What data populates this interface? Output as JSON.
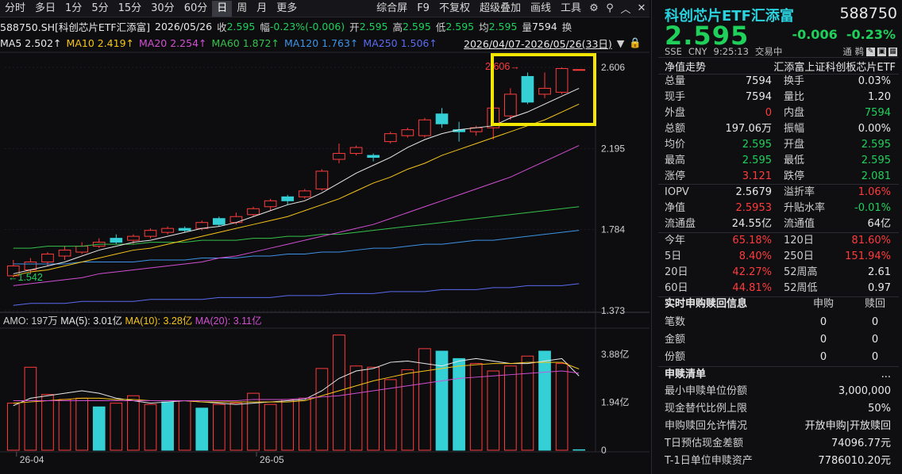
{
  "toolbar": {
    "left": [
      "分时",
      "多日",
      "1分",
      "5分",
      "15分",
      "30分",
      "60分",
      "日",
      "周",
      "月",
      "更多"
    ],
    "active": "日",
    "right": [
      "综合屏",
      "F9",
      "不复权",
      "超级叠加",
      "画线",
      "工具"
    ]
  },
  "info": {
    "code": "588750.SH[科创芯片ETF汇添富]",
    "date": "2026/05/26",
    "close_label": "收",
    "close": "2.595",
    "range_label": "幅",
    "range": "-0.23%(-0.006)",
    "open_label": "开",
    "open": "2.595",
    "high_label": "高",
    "high": "2.595",
    "low_label": "低",
    "low": "2.595",
    "avg_label": "均",
    "avg": "2.595",
    "vol_label": "量",
    "vol": "7594",
    "more": "换"
  },
  "ma_row": {
    "ma5": "MA5 2.502↑",
    "ma10": "MA10 2.419↑",
    "ma20": "MA20 2.254↑",
    "ma60": "MA60 1.872↑",
    "ma120": "MA120 1.763↑",
    "ma250": "MA250 1.506↑",
    "range": "2026/04/07-2026/05/26(33日)"
  },
  "colors": {
    "up": "#ff3b3b",
    "down_fill": "#35d0d6",
    "ma5": "#e8e8e8",
    "ma10": "#f5c518",
    "ma20": "#d24fd2",
    "ma60": "#35c24a",
    "ma120": "#3d93e6",
    "ma250": "#5a6bf0",
    "highlight": "#f3e600"
  },
  "chart_data": {
    "type": "candlestick",
    "x_ticks": [
      "26-04",
      "26-05"
    ],
    "price_axis": [
      "2.606",
      "2.195",
      "1.784",
      "1.373"
    ],
    "ylim": [
      1.373,
      2.606
    ],
    "max_marker": "2.606",
    "min_marker": "1.542",
    "candles": [
      {
        "o": 1.55,
        "c": 1.6,
        "h": 1.63,
        "l": 1.542
      },
      {
        "o": 1.58,
        "c": 1.62,
        "h": 1.64,
        "l": 1.56
      },
      {
        "o": 1.62,
        "c": 1.66,
        "h": 1.67,
        "l": 1.6
      },
      {
        "o": 1.65,
        "c": 1.68,
        "h": 1.7,
        "l": 1.63
      },
      {
        "o": 1.67,
        "c": 1.7,
        "h": 1.72,
        "l": 1.66
      },
      {
        "o": 1.7,
        "c": 1.72,
        "h": 1.74,
        "l": 1.69
      },
      {
        "o": 1.74,
        "c": 1.72,
        "h": 1.76,
        "l": 1.71
      },
      {
        "o": 1.73,
        "c": 1.75,
        "h": 1.76,
        "l": 1.71
      },
      {
        "o": 1.75,
        "c": 1.78,
        "h": 1.79,
        "l": 1.74
      },
      {
        "o": 1.77,
        "c": 1.79,
        "h": 1.8,
        "l": 1.76
      },
      {
        "o": 1.79,
        "c": 1.78,
        "h": 1.8,
        "l": 1.77
      },
      {
        "o": 1.79,
        "c": 1.82,
        "h": 1.83,
        "l": 1.78
      },
      {
        "o": 1.84,
        "c": 1.81,
        "h": 1.85,
        "l": 1.8
      },
      {
        "o": 1.82,
        "c": 1.85,
        "h": 1.87,
        "l": 1.81
      },
      {
        "o": 1.86,
        "c": 1.89,
        "h": 1.9,
        "l": 1.85
      },
      {
        "o": 1.9,
        "c": 1.93,
        "h": 1.94,
        "l": 1.88
      },
      {
        "o": 1.95,
        "c": 1.93,
        "h": 1.96,
        "l": 1.91
      },
      {
        "o": 1.95,
        "c": 1.98,
        "h": 1.99,
        "l": 1.94
      },
      {
        "o": 1.99,
        "c": 2.08,
        "h": 2.09,
        "l": 1.98
      },
      {
        "o": 2.14,
        "c": 2.17,
        "h": 2.22,
        "l": 2.12
      },
      {
        "o": 2.17,
        "c": 2.2,
        "h": 2.21,
        "l": 2.16
      },
      {
        "o": 2.16,
        "c": 2.15,
        "h": 2.17,
        "l": 2.13
      },
      {
        "o": 2.23,
        "c": 2.27,
        "h": 2.28,
        "l": 2.22
      },
      {
        "o": 2.26,
        "c": 2.29,
        "h": 2.3,
        "l": 2.25
      },
      {
        "o": 2.26,
        "c": 2.34,
        "h": 2.35,
        "l": 2.25
      },
      {
        "o": 2.37,
        "c": 2.32,
        "h": 2.4,
        "l": 2.3
      },
      {
        "o": 2.29,
        "c": 2.28,
        "h": 2.33,
        "l": 2.23
      },
      {
        "o": 2.28,
        "c": 2.3,
        "h": 2.31,
        "l": 2.26
      },
      {
        "o": 2.3,
        "c": 2.4,
        "h": 2.41,
        "l": 2.24
      },
      {
        "o": 2.36,
        "c": 2.47,
        "h": 2.5,
        "l": 2.34
      },
      {
        "o": 2.56,
        "c": 2.43,
        "h": 2.58,
        "l": 2.42
      },
      {
        "o": 2.47,
        "c": 2.5,
        "h": 2.58,
        "l": 2.45
      },
      {
        "o": 2.48,
        "c": 2.6,
        "h": 2.606,
        "l": 2.47
      },
      {
        "o": 2.595,
        "c": 2.595,
        "h": 2.595,
        "l": 2.595
      }
    ],
    "ma5": [
      1.56,
      1.58,
      1.6,
      1.62,
      1.65,
      1.68,
      1.7,
      1.72,
      1.73,
      1.75,
      1.77,
      1.79,
      1.8,
      1.82,
      1.85,
      1.88,
      1.91,
      1.93,
      1.97,
      2.02,
      2.07,
      2.11,
      2.15,
      2.2,
      2.24,
      2.27,
      2.29,
      2.3,
      2.31,
      2.35,
      2.38,
      2.42,
      2.46,
      2.5
    ],
    "ma10": [
      1.55,
      1.57,
      1.58,
      1.6,
      1.62,
      1.64,
      1.66,
      1.68,
      1.69,
      1.71,
      1.73,
      1.75,
      1.77,
      1.79,
      1.81,
      1.83,
      1.85,
      1.88,
      1.91,
      1.94,
      1.98,
      2.02,
      2.05,
      2.09,
      2.12,
      2.16,
      2.19,
      2.22,
      2.25,
      2.28,
      2.31,
      2.34,
      2.38,
      2.42
    ],
    "ma20": [
      1.5,
      1.51,
      1.52,
      1.53,
      1.54,
      1.56,
      1.57,
      1.58,
      1.59,
      1.6,
      1.61,
      1.62,
      1.64,
      1.65,
      1.67,
      1.69,
      1.71,
      1.73,
      1.75,
      1.77,
      1.79,
      1.81,
      1.84,
      1.87,
      1.9,
      1.93,
      1.96,
      1.99,
      2.02,
      2.05,
      2.09,
      2.13,
      2.17,
      2.21
    ],
    "ma60": [
      1.69,
      1.69,
      1.7,
      1.7,
      1.7,
      1.71,
      1.71,
      1.71,
      1.72,
      1.72,
      1.72,
      1.73,
      1.73,
      1.73,
      1.74,
      1.74,
      1.75,
      1.75,
      1.76,
      1.76,
      1.77,
      1.78,
      1.79,
      1.8,
      1.81,
      1.82,
      1.83,
      1.84,
      1.85,
      1.86,
      1.87,
      1.88,
      1.89,
      1.9
    ],
    "ma120": [
      1.61,
      1.61,
      1.61,
      1.61,
      1.62,
      1.62,
      1.62,
      1.62,
      1.63,
      1.63,
      1.63,
      1.64,
      1.64,
      1.64,
      1.65,
      1.65,
      1.66,
      1.66,
      1.67,
      1.67,
      1.68,
      1.69,
      1.69,
      1.7,
      1.71,
      1.71,
      1.72,
      1.73,
      1.73,
      1.74,
      1.75,
      1.76,
      1.77,
      1.78
    ],
    "ma250": [
      1.4,
      1.41,
      1.41,
      1.41,
      1.42,
      1.42,
      1.42,
      1.42,
      1.43,
      1.43,
      1.43,
      1.43,
      1.44,
      1.44,
      1.44,
      1.44,
      1.45,
      1.45,
      1.45,
      1.46,
      1.46,
      1.46,
      1.47,
      1.47,
      1.47,
      1.48,
      1.48,
      1.48,
      1.49,
      1.49,
      1.5,
      1.5,
      1.5,
      1.51
    ],
    "volume_header": {
      "amo": "AMO: 197万",
      "ma5": "MA(5): 3.01亿",
      "ma10": "MA(10): 3.28亿",
      "ma20": "MA(20): 3.11亿"
    },
    "vol_axis": [
      "3.88亿",
      "1.94亿",
      "0"
    ],
    "vol_ylim": [
      0,
      4.8
    ],
    "volumes": [
      1.9,
      3.35,
      2.25,
      2.05,
      2.1,
      1.75,
      1.9,
      2.2,
      1.85,
      1.95,
      2.0,
      1.7,
      1.85,
      1.9,
      2.3,
      1.85,
      2.05,
      2.1,
      3.3,
      4.65,
      3.4,
      3.35,
      2.85,
      3.25,
      4.1,
      4.0,
      3.7,
      3.5,
      3.2,
      3.4,
      3.8,
      4.0,
      3.5,
      0.02
    ],
    "vol_down": [
      false,
      false,
      false,
      false,
      false,
      true,
      false,
      false,
      false,
      true,
      false,
      true,
      false,
      false,
      false,
      false,
      false,
      false,
      false,
      false,
      false,
      false,
      false,
      false,
      false,
      true,
      true,
      false,
      false,
      false,
      false,
      true,
      false,
      true
    ],
    "vol_ma5": [
      1.8,
      2.1,
      2.2,
      2.3,
      2.4,
      2.3,
      2.1,
      2.0,
      1.9,
      1.95,
      2.0,
      1.95,
      1.9,
      1.85,
      1.9,
      1.95,
      2.0,
      2.05,
      2.4,
      2.9,
      3.2,
      3.3,
      3.55,
      3.6,
      3.5,
      3.4,
      3.6,
      3.7,
      3.6,
      3.5,
      3.5,
      3.6,
      3.7,
      3.0
    ],
    "vol_ma10": [
      1.9,
      1.95,
      2.0,
      2.05,
      2.1,
      2.1,
      2.05,
      2.05,
      2.0,
      2.0,
      2.0,
      1.95,
      1.95,
      1.95,
      1.95,
      1.95,
      1.95,
      2.0,
      2.2,
      2.4,
      2.6,
      2.8,
      2.95,
      3.1,
      3.2,
      3.3,
      3.4,
      3.45,
      3.5,
      3.5,
      3.55,
      3.55,
      3.55,
      3.28
    ],
    "vol_ma20": [
      2.0,
      2.0,
      2.0,
      2.0,
      2.0,
      2.0,
      2.0,
      2.0,
      2.0,
      2.0,
      2.0,
      2.0,
      2.0,
      2.0,
      2.05,
      2.05,
      2.05,
      2.1,
      2.15,
      2.2,
      2.3,
      2.4,
      2.5,
      2.6,
      2.7,
      2.8,
      2.9,
      2.95,
      3.0,
      3.05,
      3.1,
      3.15,
      3.2,
      3.11
    ]
  },
  "right": {
    "name": "科创芯片ETF汇添富",
    "code": "588750",
    "price": "2.595",
    "change": "-0.006",
    "change_pct": "-0.23%",
    "market": "SSE",
    "currency": "CNY",
    "time": "9:25:13",
    "status": "交易中",
    "tools_label": "通 鹈",
    "nav_title": "净值走势",
    "nav_name": "汇添富上证科创板芯片ETF",
    "quote_rows": [
      {
        "l1": "总量",
        "v1": "7594",
        "c1": "white",
        "l2": "换手",
        "v2": "0.03%",
        "c2": "white"
      },
      {
        "l1": "现手",
        "v1": "7594",
        "c1": "white",
        "l2": "量比",
        "v2": "1.20",
        "c2": "white"
      },
      {
        "l1": "外盘",
        "v1": "0",
        "c1": "red",
        "l2": "内盘",
        "v2": "7594",
        "c2": "green"
      },
      {
        "l1": "总额",
        "v1": "197.06万",
        "c1": "white",
        "l2": "振幅",
        "v2": "0.00%",
        "c2": "white"
      },
      {
        "l1": "均价",
        "v1": "2.595",
        "c1": "green",
        "l2": "开盘",
        "v2": "2.595",
        "c2": "green"
      },
      {
        "l1": "最高",
        "v1": "2.595",
        "c1": "green",
        "l2": "最低",
        "v2": "2.595",
        "c2": "green"
      },
      {
        "l1": "涨停",
        "v1": "3.121",
        "c1": "red",
        "l2": "跌停",
        "v2": "2.081",
        "c2": "green"
      }
    ],
    "iopv_rows": [
      {
        "l1": "IOPV",
        "v1": "2.5679",
        "c1": "white",
        "l2": "溢折率",
        "v2": "1.06%",
        "c2": "red"
      },
      {
        "l1": "净值",
        "v1": "2.5953",
        "c1": "red",
        "l2": "升贴水率",
        "v2": "-0.01%",
        "c2": "green"
      },
      {
        "l1": "流通盘",
        "v1": "24.55亿",
        "c1": "white",
        "l2": "流通值",
        "v2": "64亿",
        "c2": "white"
      }
    ],
    "perf_rows": [
      {
        "l1": "今年",
        "v1": "65.18%",
        "c1": "red",
        "l2": "120日",
        "v2": "81.60%",
        "c2": "red"
      },
      {
        "l1": "5日",
        "v1": "8.40%",
        "c1": "red",
        "l2": "250日",
        "v2": "151.94%",
        "c2": "red"
      },
      {
        "l1": "20日",
        "v1": "42.27%",
        "c1": "red",
        "l2": "52周高",
        "v2": "2.61",
        "c2": "white"
      },
      {
        "l1": "60日",
        "v1": "44.81%",
        "c1": "red",
        "l2": "52周低",
        "v2": "0.97",
        "c2": "white"
      }
    ],
    "sub_title": "实时申购赎回信息",
    "sub_col1": "申购",
    "sub_col2": "赎回",
    "sub_rows": [
      {
        "l": "笔数",
        "a": "0",
        "b": "0"
      },
      {
        "l": "金额",
        "a": "0",
        "b": "0"
      },
      {
        "l": "份额",
        "a": "0",
        "b": "0"
      }
    ],
    "list_title": "申赎清单",
    "list_more": "...",
    "list_rows": [
      {
        "l": "最小申赎单位份额",
        "v": "3,000,000"
      },
      {
        "l": "现金替代比例上限",
        "v": "50%"
      },
      {
        "l": "申购赎回允许情况",
        "v": "开放申购|开放赎回"
      },
      {
        "l": "T日预估现金差额",
        "v": "74096.77元"
      },
      {
        "l": "T-1日单位申赎资产",
        "v": "7786010.20元"
      }
    ]
  }
}
